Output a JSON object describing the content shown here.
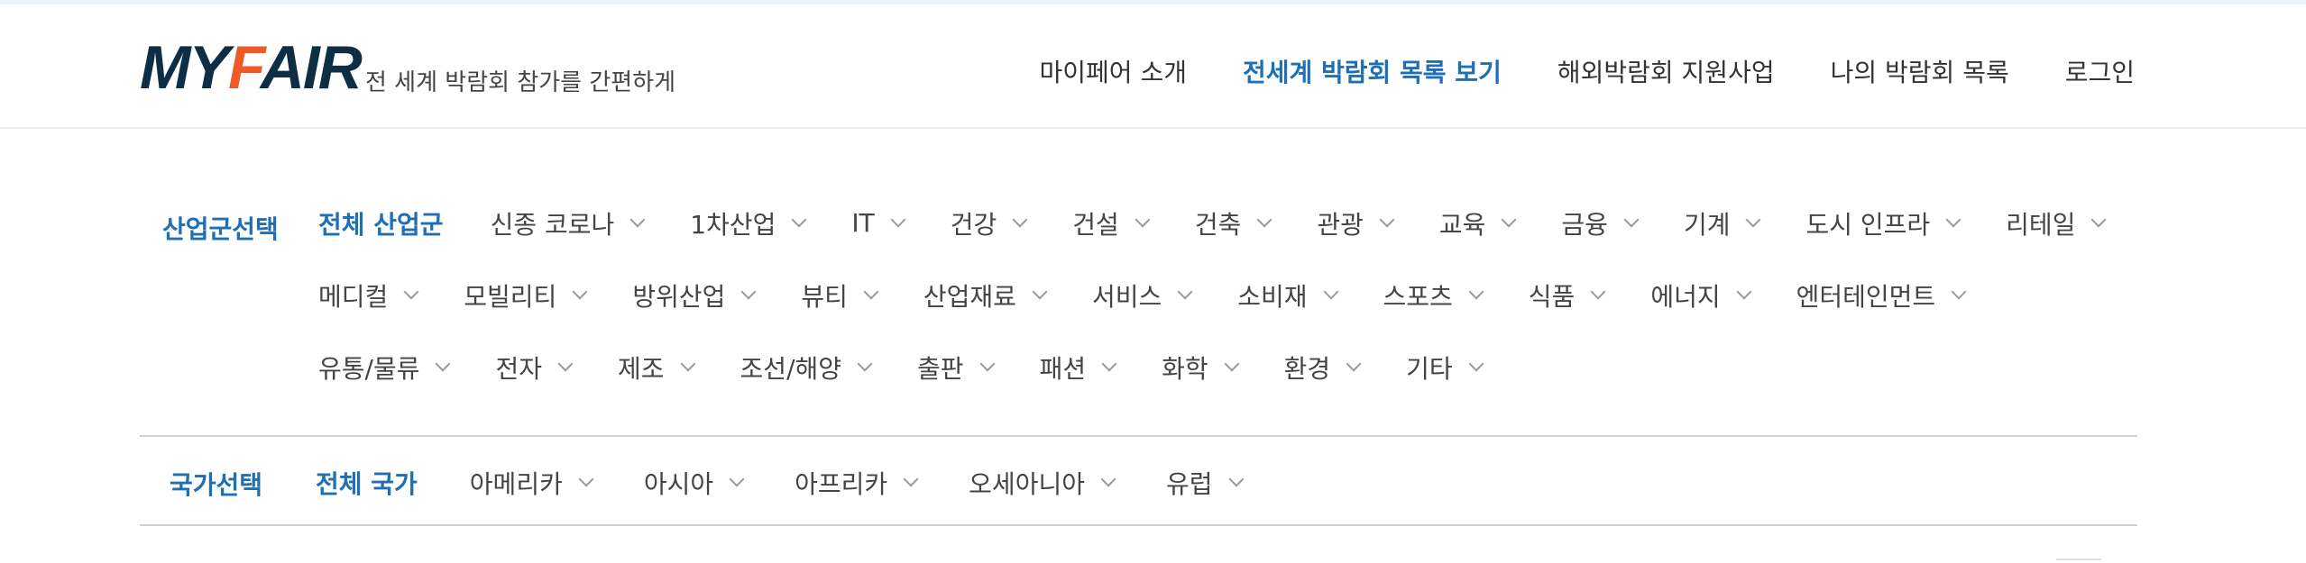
{
  "header": {
    "logo": {
      "part1": "MY",
      "part2": "F",
      "part3": "AIR"
    },
    "tagline": "전 세계 박람회 참가를 간편하게",
    "nav": [
      {
        "label": "마이페어 소개",
        "active": false
      },
      {
        "label": "전세계 박람회 목록 보기",
        "active": true
      },
      {
        "label": "해외박람회 지원사업",
        "active": false
      },
      {
        "label": "나의 박람회 목록",
        "active": false
      },
      {
        "label": "로그인",
        "active": false
      }
    ]
  },
  "industry_filter": {
    "title": "산업군선택",
    "all_label": "전체 산업군",
    "options": [
      "신종 코로나",
      "1차산업",
      "IT",
      "건강",
      "건설",
      "건축",
      "관광",
      "교육",
      "금융",
      "기계",
      "도시 인프라",
      "리테일",
      "메디컬",
      "모빌리티",
      "방위산업",
      "뷰티",
      "산업재료",
      "서비스",
      "소비재",
      "스포츠",
      "식품",
      "에너지",
      "엔터테인먼트",
      "유통/물류",
      "전자",
      "제조",
      "조선/해양",
      "출판",
      "패션",
      "화학",
      "환경",
      "기타"
    ]
  },
  "country_filter": {
    "title": "국가선택",
    "all_label": "전체 국가",
    "options": [
      "아메리카",
      "아시아",
      "아프리카",
      "오세아니아",
      "유럽"
    ]
  },
  "colors": {
    "accent": "#1f6fb5",
    "logo_dark": "#0d2e44",
    "logo_orange": "#f05a28",
    "text": "#444444"
  }
}
